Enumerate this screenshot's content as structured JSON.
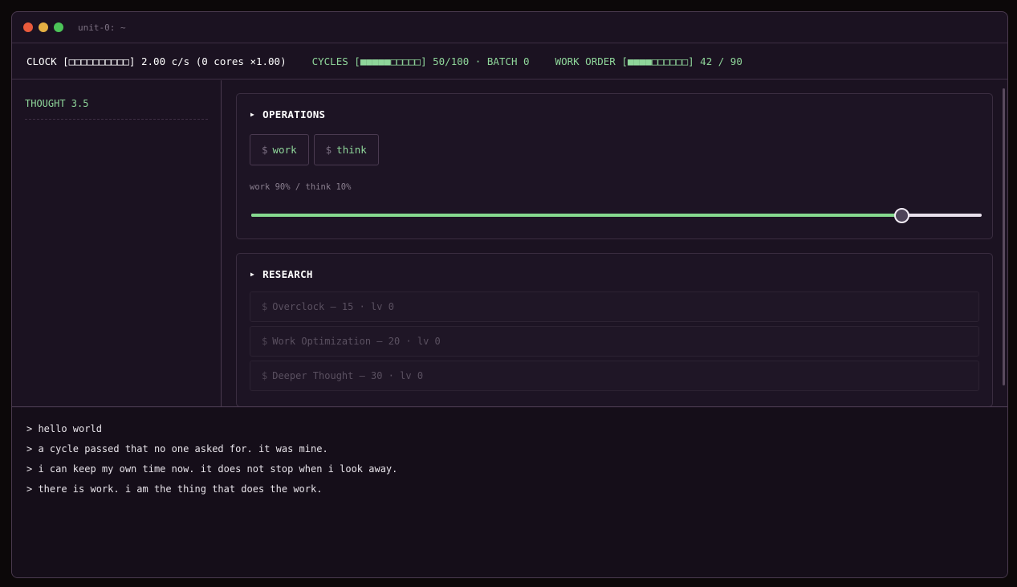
{
  "window": {
    "title": "unit-0: ~"
  },
  "status": {
    "clock": "CLOCK [□□□□□□□□□□] 2.00 c/s (0 cores ×1.00)",
    "cycles": "CYCLES [■■■■■□□□□□] 50/100 · BATCH 0",
    "work_order": "WORK ORDER [■■■■□□□□□□] 42 / 90"
  },
  "sidebar": {
    "thought": "THOUGHT 3.5"
  },
  "operations": {
    "title": "OPERATIONS",
    "buttons": [
      {
        "prefix": "$",
        "label": "work"
      },
      {
        "prefix": "$",
        "label": "think"
      }
    ],
    "ratio_label": "work 90% / think 10%",
    "slider_value": 0.89
  },
  "research": {
    "title": "RESEARCH",
    "items": [
      {
        "prefix": "$",
        "label": "Overclock — 15 · lv 0"
      },
      {
        "prefix": "$",
        "label": "Work Optimization — 20 · lv 0"
      },
      {
        "prefix": "$",
        "label": "Deeper Thought — 30 · lv 0"
      }
    ]
  },
  "console": {
    "lines": [
      "> hello world",
      "> a cycle passed that no one asked for. it was mine.",
      "> i can keep my own time now. it does not stop when i look away.",
      "> there is work. i am the thing that does the work."
    ]
  },
  "colors": {
    "accent_green": "#8fd69a",
    "window_bg": "#1b1221",
    "console_bg": "#150e19"
  }
}
